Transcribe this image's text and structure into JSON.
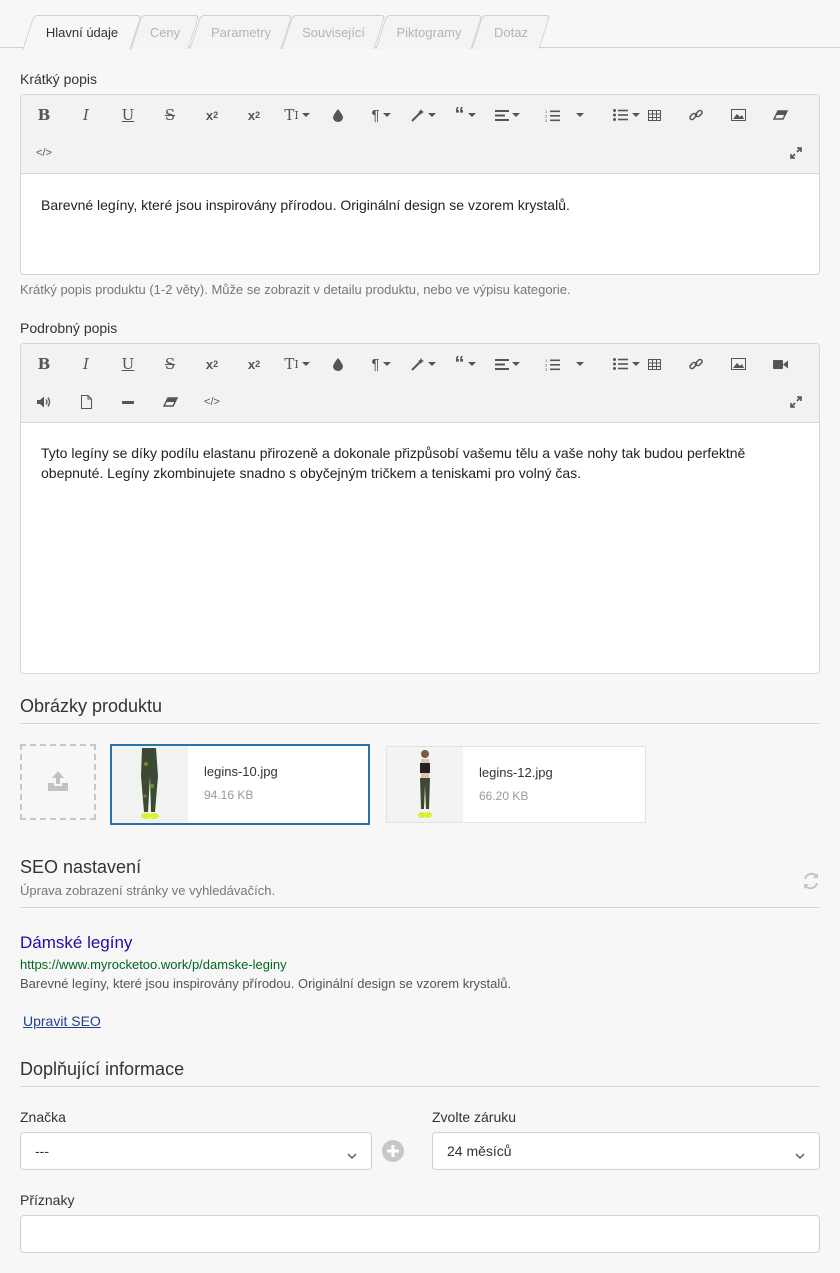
{
  "tabs": [
    {
      "label": "Hlavní údaje",
      "active": true
    },
    {
      "label": "Ceny"
    },
    {
      "label": "Parametry"
    },
    {
      "label": "Související"
    },
    {
      "label": "Piktogramy"
    },
    {
      "label": "Dotaz"
    }
  ],
  "short_desc": {
    "label": "Krátký popis",
    "content": "Barevné legíny, které jsou inspirovány přírodou. Originální design se vzorem krystalů.",
    "help": "Krátký popis produktu (1-2 věty). Může se zobrazit v detailu produktu, nebo ve výpisu kategorie."
  },
  "long_desc": {
    "label": "Podrobný popis",
    "content": "Tyto legíny se díky podílu elastanu přirozeně a dokonale přizpůsobí vašemu tělu a vaše nohy tak budou perfektně obepnuté. Legíny zkombinujete snadno s obyčejným tričkem a teniskami pro volný čas."
  },
  "images": {
    "title": "Obrázky produktu",
    "items": [
      {
        "name": "legins-10.jpg",
        "size": "94.16 KB",
        "selected": true
      },
      {
        "name": "legins-12.jpg",
        "size": "66.20 KB",
        "selected": false
      }
    ]
  },
  "seo": {
    "title": "SEO nastavení",
    "subtitle": "Úprava zobrazení stránky ve vyhledávačích.",
    "preview_title": "Dámské legíny",
    "preview_url": "https://www.myrocketoo.work/p/damske-leginy",
    "preview_desc": "Barevné legíny, které jsou inspirovány přírodou. Originální design se vzorem krystalů.",
    "edit_link": "Upravit SEO"
  },
  "extra": {
    "title": "Doplňující informace",
    "brand_label": "Značka",
    "brand_value": "---",
    "warranty_label": "Zvolte záruku",
    "warranty_value": "24 měsíců",
    "flags_label": "Příznaky",
    "flags_value": ""
  },
  "colors": {
    "selected_border": "#2a73a6",
    "seo_title": "#1a0dab",
    "seo_url": "#006621"
  }
}
